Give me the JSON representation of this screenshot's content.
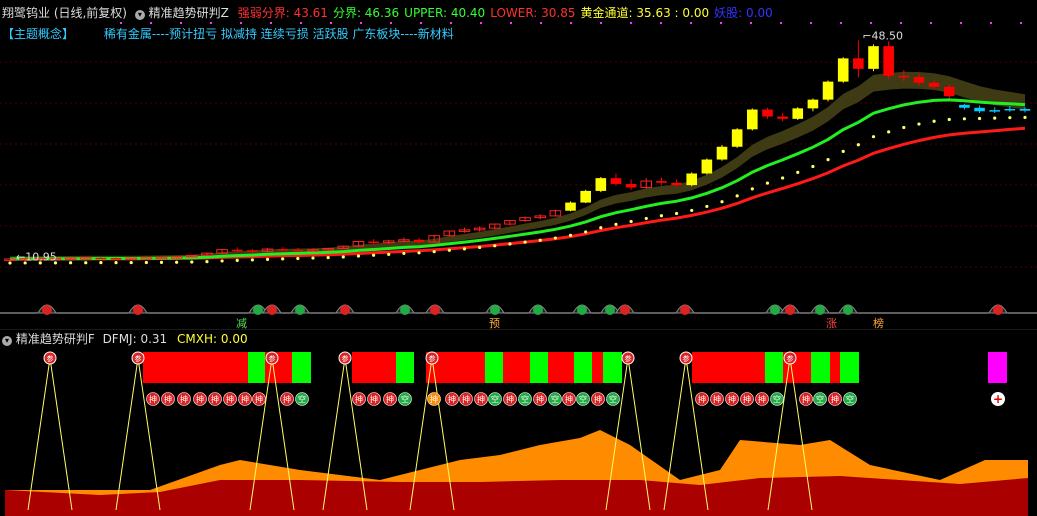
{
  "header": {
    "stock_title": "翔鹭钨业 (日线,前复权)",
    "indicator_name": "精准趋势研判Z",
    "items": [
      {
        "label": "强弱分界:",
        "value": "43.61",
        "color": "#ff3030"
      },
      {
        "label": "分界:",
        "value": "46.36",
        "color": "#33ff33"
      },
      {
        "label": "UPPER:",
        "value": "40.40",
        "color": "#33ff33"
      },
      {
        "label": "LOWER:",
        "value": "30.85",
        "color": "#ff3030"
      },
      {
        "label": "黄金通道:",
        "value": "35.63 : 0.00",
        "color": "#ffff33"
      },
      {
        "label": "妖股:",
        "value": "0.00",
        "color": "#3333ff"
      }
    ],
    "concept_tag": "【主题概念】",
    "concepts": "稀有金属----预计扭亏 拟减持 连续亏损 活跃股 广东板块----新材料"
  },
  "sub_header": {
    "indicator_name": "精准趋势研判F",
    "dfmj_label": "DFMJ:",
    "dfmj_value": "0.31",
    "cmxh_label": "CMXH:",
    "cmxh_value": "0.00"
  },
  "chart_data": {
    "type": "candlestick",
    "annotations": {
      "high": "48.50",
      "low": "10.95"
    },
    "ohlc": [
      [
        10.9,
        11.0,
        10.8,
        10.9
      ],
      [
        10.9,
        11.0,
        10.8,
        10.95
      ],
      [
        10.95,
        11.1,
        10.9,
        11.0
      ],
      [
        11.0,
        11.1,
        10.9,
        11.0
      ],
      [
        11.0,
        11.1,
        10.9,
        11.05
      ],
      [
        11.05,
        11.2,
        11.0,
        11.1
      ],
      [
        11.1,
        11.2,
        11.0,
        11.05
      ],
      [
        11.05,
        11.1,
        10.9,
        11.0
      ],
      [
        11.0,
        11.1,
        10.9,
        11.05
      ],
      [
        11.05,
        11.15,
        11.0,
        11.1
      ],
      [
        11.1,
        11.3,
        11.05,
        11.2
      ],
      [
        11.2,
        11.4,
        11.1,
        11.3
      ],
      [
        11.3,
        11.6,
        11.2,
        11.5
      ],
      [
        11.5,
        12.0,
        11.4,
        11.9
      ],
      [
        11.9,
        12.6,
        11.8,
        12.5
      ],
      [
        12.5,
        12.9,
        12.2,
        12.4
      ],
      [
        12.4,
        12.6,
        12.0,
        12.2
      ],
      [
        12.2,
        12.8,
        12.1,
        12.6
      ],
      [
        12.6,
        12.9,
        12.3,
        12.5
      ],
      [
        12.5,
        12.8,
        12.2,
        12.4
      ],
      [
        12.4,
        12.7,
        12.2,
        12.5
      ],
      [
        12.5,
        12.8,
        12.3,
        12.7
      ],
      [
        12.7,
        13.2,
        12.6,
        13.1
      ],
      [
        13.1,
        14.0,
        13.0,
        13.9
      ],
      [
        13.9,
        14.3,
        13.5,
        13.7
      ],
      [
        13.7,
        14.2,
        13.5,
        14.0
      ],
      [
        14.0,
        14.6,
        13.8,
        14.2
      ],
      [
        14.2,
        14.5,
        13.6,
        13.8
      ],
      [
        13.8,
        15.0,
        13.7,
        14.9
      ],
      [
        14.9,
        15.8,
        14.8,
        15.7
      ],
      [
        15.7,
        16.3,
        15.4,
        15.9
      ],
      [
        15.9,
        16.5,
        15.6,
        16.2
      ],
      [
        16.2,
        17.0,
        16.0,
        16.9
      ],
      [
        16.9,
        17.6,
        16.7,
        17.5
      ],
      [
        17.5,
        18.2,
        17.3,
        18.0
      ],
      [
        18.0,
        18.6,
        17.7,
        18.3
      ],
      [
        18.3,
        19.4,
        18.2,
        19.2
      ],
      [
        19.2,
        20.8,
        19.1,
        20.6
      ],
      [
        20.6,
        22.8,
        20.5,
        22.6
      ],
      [
        22.6,
        25.0,
        22.4,
        24.8
      ],
      [
        24.8,
        25.6,
        23.5,
        23.8
      ],
      [
        23.8,
        24.6,
        22.8,
        23.2
      ],
      [
        23.2,
        24.8,
        23.0,
        24.3
      ],
      [
        24.3,
        24.9,
        23.6,
        24.0
      ],
      [
        24.0,
        24.6,
        23.3,
        23.6
      ],
      [
        23.6,
        25.8,
        23.4,
        25.6
      ],
      [
        25.6,
        28.2,
        25.4,
        28.0
      ],
      [
        28.0,
        30.5,
        27.8,
        30.2
      ],
      [
        30.2,
        33.4,
        30.0,
        33.2
      ],
      [
        33.2,
        36.8,
        33.0,
        36.6
      ],
      [
        36.6,
        36.9,
        35.0,
        35.4
      ],
      [
        35.4,
        36.0,
        34.6,
        35.0
      ],
      [
        35.0,
        37.0,
        34.8,
        36.8
      ],
      [
        36.8,
        38.5,
        36.3,
        38.3
      ],
      [
        38.3,
        41.6,
        38.0,
        41.4
      ],
      [
        41.4,
        45.6,
        41.2,
        45.4
      ],
      [
        45.4,
        48.5,
        42.1,
        43.6
      ],
      [
        43.6,
        47.8,
        43.2,
        47.5
      ],
      [
        47.5,
        48.3,
        41.8,
        42.4
      ],
      [
        42.4,
        43.4,
        41.5,
        42.2
      ],
      [
        42.2,
        42.8,
        40.8,
        41.2
      ],
      [
        41.2,
        41.6,
        40.2,
        40.5
      ],
      [
        40.5,
        41.0,
        38.5,
        38.9
      ],
      [
        37.4,
        37.6,
        36.6,
        36.9
      ],
      [
        36.9,
        37.3,
        36.0,
        36.3
      ],
      [
        36.3,
        37.0,
        36.0,
        36.5
      ],
      [
        36.5,
        37.2,
        36.2,
        36.7
      ],
      [
        36.7,
        37.0,
        36.1,
        36.4
      ]
    ]
  },
  "bottom_labels": {
    "jian": "减",
    "yu": "预",
    "zhang": "涨",
    "bang": "榜"
  },
  "sub_chart": {
    "marker_char": "参",
    "sell_char": "抻",
    "empty_char": "空",
    "plus_char": "+"
  },
  "colors": {
    "red": "#ff0000",
    "green": "#00ff00",
    "yellow": "#ffff00",
    "olive": "#4a4a1a",
    "orange": "#ff8c00",
    "darkred": "#aa0000",
    "magenta": "#ff00ff"
  }
}
